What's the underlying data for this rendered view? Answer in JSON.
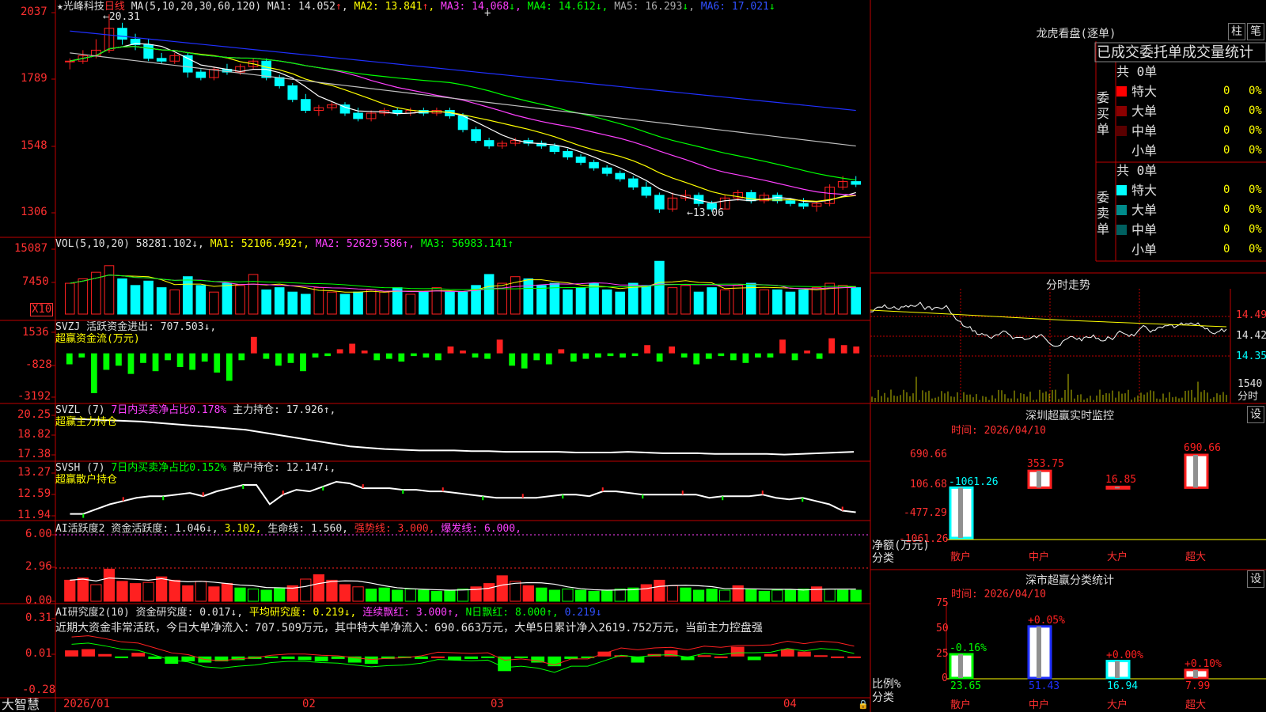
{
  "colors": {
    "up": "#ff2020",
    "down": "#00ffff",
    "ma1": "#ffffff",
    "ma2": "#ffff00",
    "ma3": "#ff40ff",
    "ma4": "#00ff00",
    "ma5": "#c0c0c0",
    "ma6": "#2030ff"
  },
  "header": {
    "star": "★",
    "stock_name": "光峰科技",
    "period": "日线",
    "ma_label": "MA(5,10,20,30,60,120)",
    "ma1": "MA1: 14.052",
    "ma2": "MA2: 13.841",
    "ma3": "MA3: 14.068",
    "ma4": "MA4: 14.612",
    "ma5": "MA5: 16.293",
    "ma6": "MA6: 17.021",
    "arrow_up": "↑",
    "arrow_down": "↓",
    "crosshair": "+"
  },
  "price_axis": [
    "2037",
    "1789",
    "1548",
    "1306"
  ],
  "price_annotations": {
    "high": "←20.31",
    "low": "←13.06"
  },
  "vol": {
    "label": "VOL(5,10,20)",
    "value": "58281.102↓",
    "ma1": "MA1: 52106.492↑",
    "ma2": "MA2: 52629.586↑",
    "ma3": "MA3: 56983.141↑",
    "axis": [
      "15087",
      "7450"
    ],
    "unit": "X10"
  },
  "svzj": {
    "label": "SVZJ",
    "text": "活跃资金进出: 707.503↓,",
    "sub": "超赢资金流(万元)",
    "axis": [
      "1536",
      "-828",
      "-3192"
    ]
  },
  "svzl": {
    "label": "SVZL (7)",
    "text1": "7日内买卖净占比0.178%",
    "text2": "主力持仓: 17.926↑,",
    "sub": "超赢主力持仓",
    "axis": [
      "20.25",
      "18.82",
      "17.38"
    ]
  },
  "svsh": {
    "label": "SVSH (7)",
    "text1": "7日内买卖净占比0.152%",
    "text2": "散户持仓: 12.147↓,",
    "sub": "超赢散户持仓",
    "axis": [
      "13.27",
      "12.59",
      "11.94"
    ]
  },
  "ai1": {
    "label": "AI活跃度2",
    "t1": "资金活跃度: 1.046↓,",
    "t2": "3.102,",
    "t3": "生命线: 1.560,",
    "t4": "强势线: 3.000,",
    "t5": "爆发线: 6.000,",
    "axis": [
      "6.00",
      "2.96",
      "0.00"
    ]
  },
  "ai2": {
    "label": "AI研究度2(10)",
    "t1": "资金研究度: 0.017↓,",
    "t2": "平均研究度: 0.219↓,",
    "t3": "连续飘红: 3.000↑,",
    "t4": "N日飘红: 8.000↑,",
    "t5": "0.219↓",
    "comment": "近期大资金非常活跃，今日大单净流入：707.509万元，其中特大单净流入：690.663万元，大单5日累计净入2619.752万元，当前主力控盘强",
    "axis": [
      "0.31",
      "0.01",
      "-0.28"
    ]
  },
  "date_axis": [
    "2026/01",
    "02",
    "03",
    "04"
  ],
  "brand": "大智慧",
  "dragon": {
    "title": "龙虎看盘(逐单)",
    "btn1": "柱",
    "btn2": "笔",
    "tabs": [
      "已成交",
      "委托单",
      "成交量统计"
    ],
    "buy_label": "委买单",
    "sell_label": "委卖单",
    "buy_total": "共 0单",
    "sell_total": "共 0单",
    "rows": [
      {
        "name": "特大",
        "count": "0",
        "pct": "0%"
      },
      {
        "name": "大单",
        "count": "0",
        "pct": "0%"
      },
      {
        "name": "中单",
        "count": "0",
        "pct": "0%"
      },
      {
        "name": "小单",
        "count": "0",
        "pct": "0%"
      }
    ]
  },
  "intraday": {
    "title": "分时走势",
    "prices": [
      "14.49",
      "14.42",
      "14.35"
    ],
    "vol": "1540",
    "vol_label": "分时"
  },
  "sz_monitor": {
    "title": "深圳超赢实时监控",
    "btn": "设",
    "time": "时间: 2026/04/10",
    "axis": [
      "690.66",
      "106.68",
      "-477.29",
      "-1061.26"
    ],
    "ylabel": "净额(万元)",
    "xlabel": "分类"
  },
  "sz_stats": {
    "title": "深市超赢分类统计",
    "btn": "设",
    "time": "时间: 2026/04/10",
    "axis": [
      "75",
      "50",
      "25",
      "0"
    ],
    "ylabel": "比例%",
    "xlabel": "分类"
  },
  "chart_data": [
    {
      "type": "candlestick",
      "title": "光峰科技 日线",
      "ylim": [
        13.0,
        20.5
      ],
      "x": [
        "2026/01",
        "02",
        "03",
        "04"
      ],
      "candles": [
        [
          18.6,
          18.7,
          18.3,
          18.6
        ],
        [
          18.6,
          19.0,
          18.5,
          18.8
        ],
        [
          18.8,
          19.4,
          18.7,
          19.0
        ],
        [
          19.0,
          20.31,
          18.9,
          19.8
        ],
        [
          19.8,
          20.0,
          19.2,
          19.4
        ],
        [
          19.4,
          19.6,
          19.0,
          19.2
        ],
        [
          19.2,
          19.4,
          18.6,
          18.7
        ],
        [
          18.7,
          18.9,
          18.5,
          18.6
        ],
        [
          18.6,
          18.9,
          18.5,
          18.8
        ],
        [
          18.8,
          18.9,
          18.0,
          18.2
        ],
        [
          18.2,
          18.3,
          17.9,
          18.0
        ],
        [
          18.0,
          18.4,
          17.9,
          18.3
        ],
        [
          18.3,
          18.5,
          18.1,
          18.2
        ],
        [
          18.2,
          18.5,
          18.1,
          18.4
        ],
        [
          18.4,
          18.7,
          18.3,
          18.6
        ],
        [
          18.6,
          18.7,
          17.9,
          18.0
        ],
        [
          18.0,
          18.1,
          17.6,
          17.7
        ],
        [
          17.7,
          17.8,
          17.1,
          17.2
        ],
        [
          17.2,
          17.4,
          16.7,
          16.8
        ],
        [
          16.8,
          17.0,
          16.6,
          16.9
        ],
        [
          16.9,
          17.1,
          16.8,
          17.0
        ],
        [
          17.0,
          17.1,
          16.6,
          16.7
        ],
        [
          16.7,
          16.9,
          16.4,
          16.5
        ],
        [
          16.5,
          16.8,
          16.4,
          16.7
        ],
        [
          16.7,
          16.9,
          16.6,
          16.8
        ],
        [
          16.8,
          16.9,
          16.6,
          16.7
        ],
        [
          16.7,
          16.9,
          16.6,
          16.8
        ],
        [
          16.8,
          16.9,
          16.6,
          16.7
        ],
        [
          16.7,
          16.9,
          16.6,
          16.8
        ],
        [
          16.8,
          16.9,
          16.5,
          16.6
        ],
        [
          16.6,
          16.7,
          16.0,
          16.1
        ],
        [
          16.1,
          16.2,
          15.6,
          15.7
        ],
        [
          15.7,
          15.8,
          15.4,
          15.5
        ],
        [
          15.5,
          15.7,
          15.4,
          15.6
        ],
        [
          15.6,
          15.8,
          15.5,
          15.7
        ],
        [
          15.7,
          15.8,
          15.5,
          15.6
        ],
        [
          15.6,
          15.7,
          15.4,
          15.5
        ],
        [
          15.5,
          15.6,
          15.2,
          15.3
        ],
        [
          15.3,
          15.4,
          15.0,
          15.1
        ],
        [
          15.1,
          15.2,
          14.8,
          14.9
        ],
        [
          14.9,
          15.0,
          14.6,
          14.7
        ],
        [
          14.7,
          14.8,
          14.4,
          14.5
        ],
        [
          14.5,
          14.6,
          14.2,
          14.3
        ],
        [
          14.3,
          14.4,
          13.9,
          14.0
        ],
        [
          14.0,
          14.2,
          13.6,
          13.7
        ],
        [
          13.7,
          13.8,
          13.06,
          13.2
        ],
        [
          13.2,
          13.8,
          13.1,
          13.6
        ],
        [
          13.6,
          13.9,
          13.5,
          13.7
        ],
        [
          13.7,
          13.8,
          13.3,
          13.4
        ],
        [
          13.4,
          13.5,
          13.1,
          13.2
        ],
        [
          13.2,
          13.7,
          13.2,
          13.6
        ],
        [
          13.6,
          13.9,
          13.5,
          13.8
        ],
        [
          13.8,
          13.9,
          13.4,
          13.5
        ],
        [
          13.5,
          13.8,
          13.4,
          13.7
        ],
        [
          13.7,
          13.8,
          13.4,
          13.5
        ],
        [
          13.5,
          13.6,
          13.3,
          13.4
        ],
        [
          13.4,
          13.6,
          13.2,
          13.3
        ],
        [
          13.3,
          13.5,
          13.1,
          13.4
        ],
        [
          13.4,
          14.1,
          13.3,
          14.0
        ],
        [
          14.0,
          14.4,
          13.9,
          14.2
        ],
        [
          14.2,
          14.4,
          14.0,
          14.1
        ]
      ]
    },
    {
      "type": "bar",
      "title": "VOL(5,10,20)",
      "ylim": [
        0,
        16000
      ],
      "values": [
        7000,
        8000,
        9500,
        11000,
        8000,
        6500,
        7500,
        6000,
        5500,
        8500,
        6500,
        5000,
        7000,
        6500,
        9000,
        5500,
        6000,
        5000,
        4500,
        6000,
        5000,
        4500,
        5000,
        5500,
        5000,
        6000,
        4500,
        5000,
        6000,
        5000,
        5000,
        6500,
        9000,
        7000,
        8500,
        8000,
        6500,
        7000,
        5500,
        6000,
        7000,
        5500,
        5000,
        7000,
        6500,
        12000,
        6000,
        6500,
        5000,
        6000,
        5500,
        6500,
        7000,
        5500,
        5500,
        5000,
        5500,
        6000,
        7000,
        6500,
        6000
      ]
    },
    {
      "type": "bar",
      "title": "SVZJ",
      "ylim": [
        -3192,
        1536
      ],
      "values": [
        -800,
        -300,
        -2900,
        -1200,
        -900,
        -1500,
        -700,
        -1300,
        -500,
        -1000,
        -1200,
        -600,
        -1400,
        -2000,
        -500,
        1200,
        -400,
        -900,
        -700,
        -1300,
        -300,
        -200,
        300,
        700,
        200,
        -500,
        -400,
        -600,
        -200,
        -300,
        -500,
        500,
        200,
        -300,
        -400,
        1000,
        -900,
        -1100,
        -500,
        -800,
        300,
        -600,
        -400,
        -300,
        -200,
        -300,
        -200,
        600,
        -600,
        500,
        -300,
        -800,
        -400,
        -200,
        -500,
        -700,
        -300,
        -300,
        1000,
        -500,
        200,
        -400,
        1100,
        600,
        500
      ]
    },
    {
      "type": "line",
      "title": "SVZL",
      "ylim": [
        17.38,
        20.25
      ],
      "values": [
        20.0,
        19.95,
        19.9,
        19.85,
        19.8,
        19.7,
        19.6,
        19.5,
        19.4,
        19.3,
        19.2,
        19.0,
        18.8,
        18.6,
        18.4,
        18.2,
        18.0,
        17.9,
        17.8,
        17.75,
        17.7,
        17.7,
        17.7,
        17.65,
        17.65,
        17.6,
        17.6,
        17.6,
        17.6,
        17.55,
        17.55,
        17.55,
        17.6,
        17.55,
        17.5,
        17.5,
        17.5,
        17.45,
        17.45,
        17.45,
        17.45,
        17.4,
        17.45,
        17.5,
        17.55,
        17.6
      ]
    },
    {
      "type": "line",
      "title": "SVSH",
      "ylim": [
        11.94,
        13.27
      ],
      "values": [
        12.0,
        12.0,
        12.15,
        12.3,
        12.4,
        12.5,
        12.55,
        12.55,
        12.6,
        12.65,
        12.55,
        12.7,
        12.8,
        12.9,
        12.9,
        12.3,
        12.6,
        12.75,
        12.7,
        12.85,
        13.0,
        12.95,
        12.8,
        12.8,
        12.8,
        12.75,
        12.75,
        12.7,
        12.7,
        12.65,
        12.6,
        12.55,
        12.5,
        12.5,
        12.5,
        12.5,
        12.55,
        12.6,
        12.6,
        12.55,
        12.7,
        12.7,
        12.65,
        12.6,
        12.6,
        12.6,
        12.6,
        12.6,
        12.5,
        12.55,
        12.55,
        12.55,
        12.6,
        12.5,
        12.45,
        12.5,
        12.4,
        12.3,
        12.1,
        12.05
      ]
    },
    {
      "type": "bar",
      "title": "AI活跃度2",
      "ylim": [
        0,
        6.0
      ],
      "values": [
        1.9,
        2.1,
        1.5,
        2.9,
        1.8,
        1.6,
        1.7,
        2.2,
        1.9,
        1.4,
        1.8,
        1.3,
        1.6,
        1.2,
        1.1,
        1.0,
        1.2,
        1.4,
        2.0,
        2.4,
        1.9,
        1.5,
        1.3,
        1.1,
        1.2,
        1.0,
        1.1,
        1.0,
        0.9,
        1.0,
        1.1,
        1.3,
        1.6,
        2.3,
        1.8,
        1.4,
        1.2,
        1.0,
        1.1,
        1.0,
        0.9,
        1.0,
        1.1,
        1.2,
        1.5,
        1.9,
        1.4,
        1.2,
        1.0,
        1.1,
        1.0,
        1.4,
        1.1,
        0.9,
        1.0,
        1.0,
        1.1,
        1.3,
        1.1,
        1.0,
        1.0
      ]
    },
    {
      "type": "bar",
      "title": "AI研究度2",
      "ylim": [
        -0.28,
        0.31
      ],
      "values": [
        0.05,
        0.06,
        0.02,
        -0.01,
        0.03,
        -0.02,
        -0.06,
        -0.04,
        -0.05,
        -0.04,
        -0.03,
        -0.02,
        -0.01,
        -0.02,
        -0.03,
        -0.04,
        -0.02,
        -0.05,
        -0.06,
        -0.02,
        -0.01,
        -0.02,
        0.0,
        -0.03,
        -0.02,
        -0.01,
        -0.12,
        -0.01,
        -0.05,
        -0.08,
        -0.02,
        -0.01,
        0.04,
        0.01,
        -0.05,
        0.02,
        0.05,
        -0.03,
        0.01,
        0.0,
        0.08,
        -0.03,
        0.02,
        0.06,
        0.04,
        0.01,
        0.0,
        0.0
      ]
    },
    {
      "type": "bar",
      "title": "深圳超赢实时监控",
      "categories": [
        "散户",
        "中户",
        "大户",
        "超大"
      ],
      "values": [
        -1061.26,
        353.75,
        16.85,
        690.66
      ],
      "ylim": [
        -1061.26,
        690.66
      ]
    },
    {
      "type": "bar",
      "title": "深市超赢分类统计",
      "categories": [
        "散户",
        "中户",
        "大户",
        "超大"
      ],
      "values": [
        23.65,
        51.43,
        16.94,
        7.99
      ],
      "labels": [
        "-0.16%",
        "+0.05%",
        "+0.00%",
        "+0.10%"
      ],
      "ylim": [
        0,
        75
      ]
    }
  ]
}
